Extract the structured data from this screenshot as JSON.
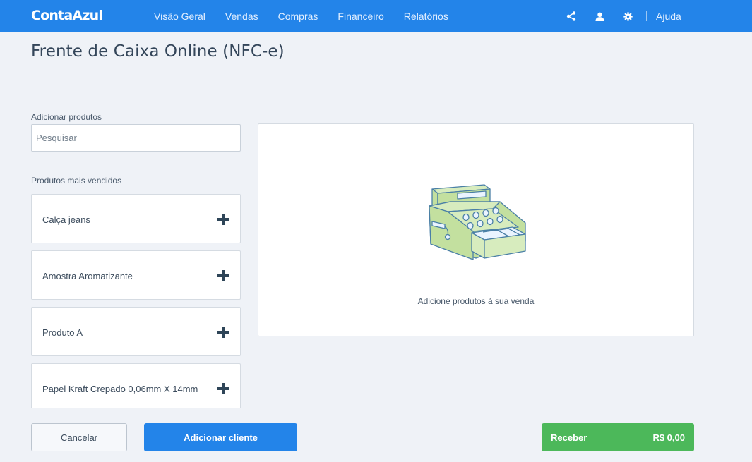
{
  "app": {
    "logo": "ContaAzul"
  },
  "nav": {
    "items": [
      "Visão Geral",
      "Vendas",
      "Compras",
      "Financeiro",
      "Relatórios"
    ],
    "help": "Ajuda",
    "icons": [
      "share-icon",
      "user-icon",
      "gear-icon"
    ]
  },
  "page": {
    "title": "Frente de Caixa Online (NFC-e)"
  },
  "search": {
    "label": "Adicionar produtos",
    "placeholder": "Pesquisar",
    "value": ""
  },
  "products": {
    "label": "Produtos mais vendidos",
    "items": [
      {
        "name": "Calça jeans"
      },
      {
        "name": "Amostra Aromatizante"
      },
      {
        "name": "Produto A"
      },
      {
        "name": "Papel Kraft Crepado 0,06mm X 14mm"
      }
    ]
  },
  "panel": {
    "empty_text": "Adicione produtos à sua venda",
    "illustration": "cash-register"
  },
  "footer": {
    "cancel_label": "Cancelar",
    "client_label": "Adicionar cliente",
    "receive_label": "Receber",
    "receive_amount": "R$ 0,00"
  },
  "colors": {
    "primary": "#2384e9",
    "success": "#4cb85a",
    "background": "#eff2f7"
  }
}
